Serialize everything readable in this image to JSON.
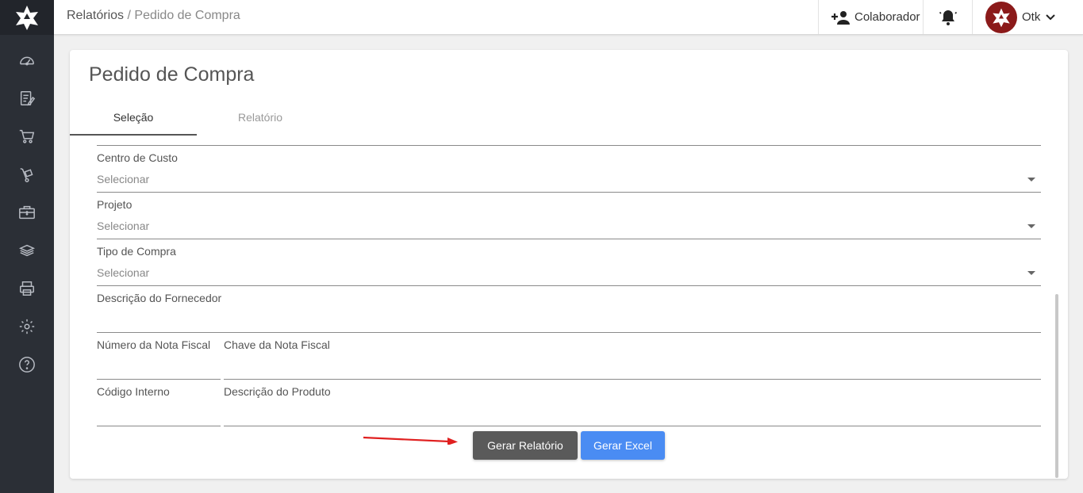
{
  "header": {
    "breadcrumb_root": "Relatórios",
    "breadcrumb_sep": "/",
    "breadcrumb_current": "Pedido de Compra",
    "collaborator_label": "Colaborador",
    "user_name": "Otk"
  },
  "sidebar": {
    "items": [
      "dashboard-icon",
      "document-edit-icon",
      "cart-icon",
      "hand-truck-icon",
      "briefcase-money-icon",
      "coins-stack-icon",
      "printer-icon",
      "gear-icon",
      "help-icon"
    ]
  },
  "page": {
    "title": "Pedido de Compra",
    "tabs": [
      {
        "label": "Seleção",
        "active": true
      },
      {
        "label": "Relatório",
        "active": false
      }
    ]
  },
  "form": {
    "cost_center": {
      "label": "Centro de Custo",
      "value": "Selecionar"
    },
    "project": {
      "label": "Projeto",
      "value": "Selecionar"
    },
    "purchase_type": {
      "label": "Tipo de Compra",
      "value": "Selecionar"
    },
    "supplier_description": {
      "label": "Descrição do Fornecedor",
      "value": ""
    },
    "invoice_number": {
      "label": "Número da Nota Fiscal",
      "value": ""
    },
    "invoice_key": {
      "label": "Chave da Nota Fiscal",
      "value": ""
    },
    "internal_code": {
      "label": "Código Interno",
      "value": ""
    },
    "product_description": {
      "label": "Descrição do Produto",
      "value": ""
    }
  },
  "actions": {
    "generate_report": "Gerar Relatório",
    "generate_excel": "Gerar Excel"
  },
  "colors": {
    "sidebar_bg": "#2b2f36",
    "report_button": "#5a5a5a",
    "excel_button": "#4a8cf3",
    "annotation_arrow": "#e02020"
  }
}
